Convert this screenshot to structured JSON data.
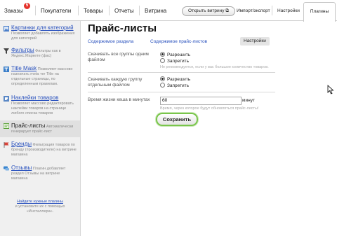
{
  "topnav": {
    "orders": "Заказы",
    "orders_badge": "5",
    "customers": "Покупатели",
    "products": "Товары",
    "reports": "Отчеты",
    "storefront": "Витрина",
    "open_storefront": "Открыть витрину",
    "import_export": "Импорт/экспорт",
    "settings": "Настройки",
    "plugins": "Плагины"
  },
  "sidebar": {
    "items": [
      {
        "title": "Картинки для категорий",
        "desc": "Позволяет добавлять изображения для категорий",
        "icon": "image-icon",
        "color": "#4a7ec9"
      },
      {
        "title": "Фильтры",
        "desc": "Фильтры как в Яндекс.Маркете (фас)",
        "icon": "funnel-icon",
        "color": "#444444"
      },
      {
        "title": "Title Mask",
        "desc": "Позволяет массово назначать meta тег Title на отдельные страницы, по определенным правилам.",
        "icon": "t-letter-icon",
        "color": "#3a7ec9"
      },
      {
        "title": "Наклейки товаров",
        "desc": "Позволяет массово редактировать наклейки товаров на странице любого списка товаров",
        "icon": "sticker-icon",
        "color": "#5b88c6"
      },
      {
        "title": "Прайс-листы",
        "desc": "Автоматически генерирует прайс-лист",
        "icon": "price-list-icon",
        "color": "#5aa23a"
      },
      {
        "title": "Бренды",
        "desc": "Фильтрация товаров по бренду (производителю) на витрине магазина",
        "icon": "flag-icon",
        "color": "#d9443a"
      },
      {
        "title": "Отзывы",
        "desc": "Плагин добавляет раздел Отзывы на витрине магазина",
        "icon": "comments-icon",
        "color": "#3a86d0"
      }
    ],
    "footer_link": "Найдите нужные плагины",
    "footer_text": "и установите их с помощью «Инсталлера»."
  },
  "main": {
    "title": "Прайс-листы",
    "tabs": [
      "Содержимое раздела",
      "Содержимое прайс-листов",
      "Настройки"
    ],
    "active_tab": "Настройки",
    "groups_label": "Скачивать все группы одним файлом",
    "groups_options": [
      "Разрешить",
      "Запретить"
    ],
    "groups_hint": "Не рекомендуется, если у вас большое количество товаров.",
    "each_label": "Скачивать каждую группу отдельным файлом",
    "each_options": [
      "Разрешить",
      "Запретить"
    ],
    "cache_label": "Время жизни кеша в минутах",
    "cache_value": "60",
    "cache_unit": "минут",
    "cache_hint": "Время, через которое будут обновляться прайс-листы!",
    "save_label": "Сохранить"
  }
}
